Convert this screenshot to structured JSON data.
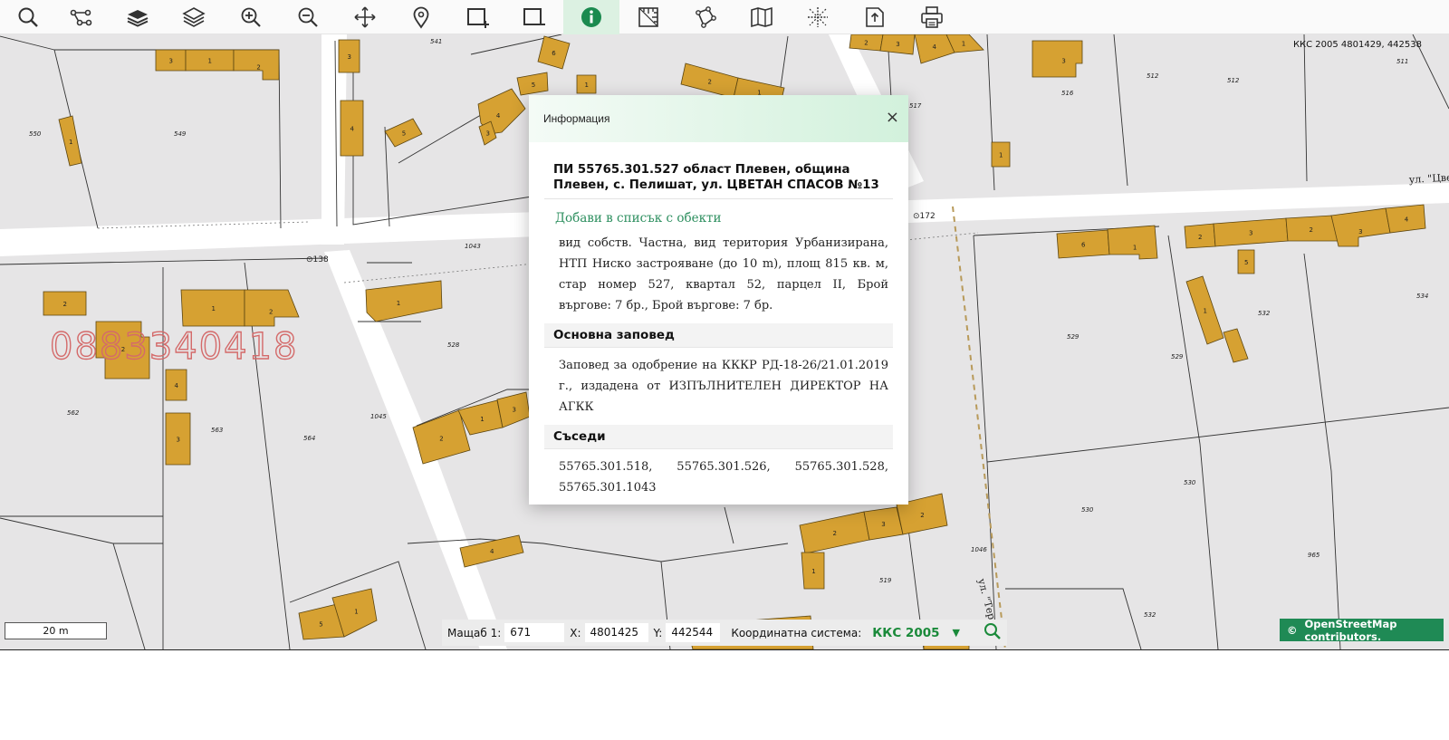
{
  "toolbar": {
    "tools": [
      {
        "name": "search-tool",
        "icon": "search-icon"
      },
      {
        "name": "route-tool",
        "icon": "route-icon"
      },
      {
        "name": "layers-solid-tool",
        "icon": "layers-solid-icon"
      },
      {
        "name": "layers-tool",
        "icon": "layers-icon"
      },
      {
        "name": "zoom-in-tool",
        "icon": "zoom-in-icon"
      },
      {
        "name": "zoom-out-tool",
        "icon": "zoom-out-icon"
      },
      {
        "name": "pan-tool",
        "icon": "move-icon"
      },
      {
        "name": "marker-tool",
        "icon": "map-pin-icon"
      },
      {
        "name": "select-add-tool",
        "icon": "rect-plus-icon"
      },
      {
        "name": "select-remove-tool",
        "icon": "rect-minus-icon"
      },
      {
        "name": "info-tool",
        "icon": "info-icon",
        "active": true
      },
      {
        "name": "measure-tool",
        "icon": "ruler-icon"
      },
      {
        "name": "polygon-tool",
        "icon": "polygon-icon"
      },
      {
        "name": "map-tool",
        "icon": "folded-map-icon"
      },
      {
        "name": "cross-tool",
        "icon": "crosshair-icon"
      },
      {
        "name": "export-tool",
        "icon": "export-icon"
      },
      {
        "name": "print-tool",
        "icon": "printer-icon"
      }
    ],
    "accent": "#dcf1e2"
  },
  "map": {
    "coord_top": "ККС 2005 4801429, 442538",
    "watermark_phone": "0883340418",
    "street_labels": {
      "cvetan": "ул. \"Цвета",
      "tereza": "ул. \"Тереза\"",
      "p138": "⊙138",
      "p172": "⊙172"
    },
    "parcel_labels": [
      "550",
      "549",
      "541",
      "516",
      "512",
      "512",
      "511",
      "517",
      "562",
      "563",
      "564",
      "1045",
      "528",
      "1043",
      "529",
      "529",
      "532",
      "534",
      "530",
      "530",
      "965",
      "519",
      "532",
      "1046"
    ],
    "building_labels": [
      "3",
      "1",
      "2",
      "3",
      "4",
      "5",
      "6",
      "4",
      "3",
      "5",
      "1",
      "2",
      "1",
      "2",
      "3",
      "4",
      "1",
      "3",
      "1",
      "1",
      "2",
      "1",
      "2",
      "1",
      "2",
      "4",
      "3",
      "2",
      "1",
      "3",
      "4",
      "5",
      "1",
      "2",
      "3",
      "2",
      "1",
      "6",
      "1",
      "2",
      "3",
      "2",
      "3",
      "4",
      "5",
      "1"
    ],
    "colors": {
      "background": "#e6e5e6",
      "building": "#d6a132",
      "building_stroke": "#5a4410",
      "road": "#ffffff"
    }
  },
  "popup": {
    "title": "Информация",
    "close": "×",
    "parcel_title": "ПИ 55765.301.527 област Плевен, община Плевен, с. Пелишат, ул. ЦВЕТАН СПАСОВ №13",
    "add_link": "Добави в списък с обекти",
    "description": "вид собств. Частна, вид територия Урбанизирана, НТП Ниско застрояване (до 10 m), площ 815 кв. м, стар номер 527, квартал 52, парцел II, Брой въргове: 7 бр., Брой въргове: 7 бр.",
    "main_order_heading": "Основна заповед",
    "main_order_text": "Заповед за одобрение на КККР РД-18-26/21.01.2019 г., издадена от ИЗПЪЛНИТЕЛЕН ДИРЕКТОР НА АГКК",
    "neighbours_heading": "Съседи",
    "neighbours": [
      "55765.301.518,",
      "55765.301.526,",
      "55765.301.528,",
      "55765.301.1043"
    ]
  },
  "status": {
    "scale_label": "Мащаб 1:",
    "scale_value": "671",
    "x_label": "X:",
    "x_value": "4801425",
    "y_label": "Y:",
    "y_value": "442544",
    "crs_label": "Координатна система:",
    "crs_value": "ККС 2005",
    "crs_dropdown": "▼"
  },
  "scalebar": {
    "label": "20 m"
  },
  "attribution": {
    "symbol": "©",
    "text": "OpenStreetMap contributors."
  }
}
